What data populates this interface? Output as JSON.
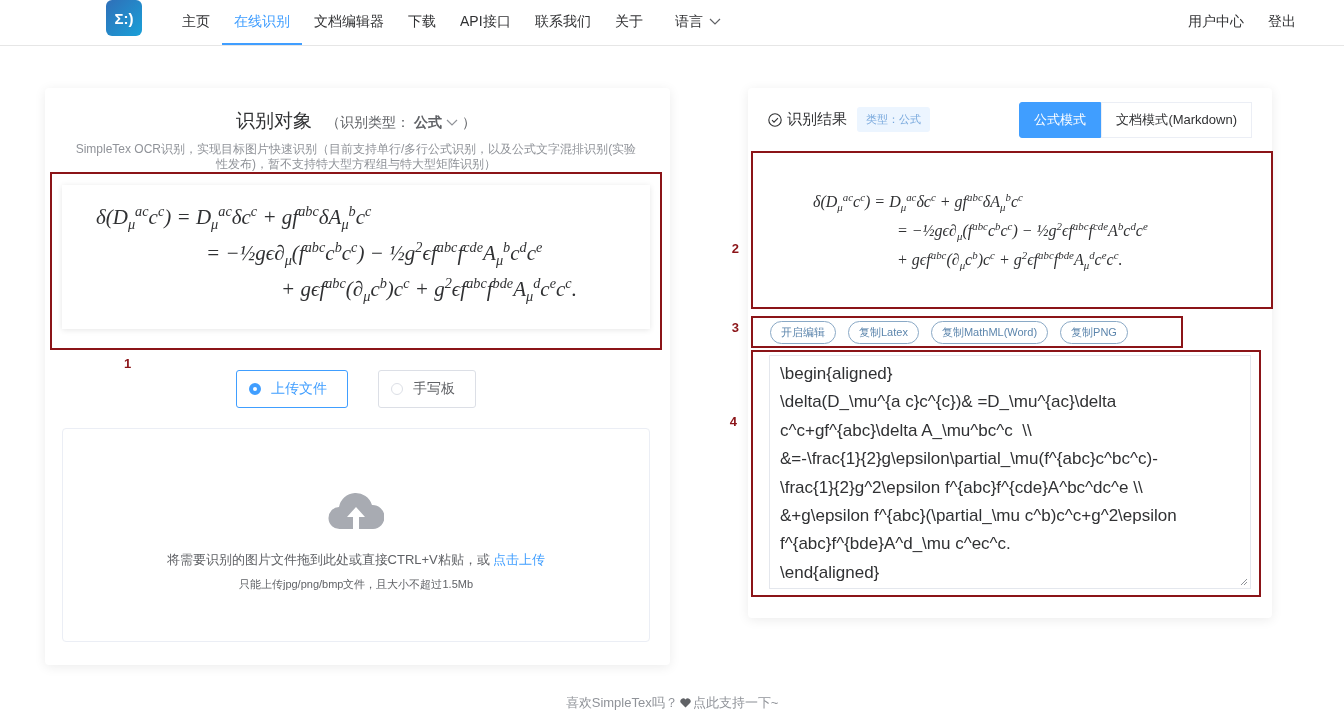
{
  "nav": {
    "logo": "Σ:)",
    "items": [
      {
        "label": "主页",
        "selected": false,
        "kind": "link"
      },
      {
        "label": "在线识别",
        "selected": true,
        "kind": "link"
      },
      {
        "label": "文档编辑器",
        "selected": false,
        "kind": "link"
      },
      {
        "label": "下载",
        "selected": false,
        "kind": "link"
      },
      {
        "label": "API接口",
        "selected": false,
        "kind": "link"
      },
      {
        "label": "联系我们",
        "selected": false,
        "kind": "link"
      },
      {
        "label": "关于",
        "selected": false,
        "kind": "link"
      },
      {
        "label": "语言",
        "selected": false,
        "kind": "dropdown"
      }
    ],
    "user_links": [
      "用户中心",
      "登出"
    ]
  },
  "source_panel": {
    "title": "识别对象",
    "type_label": "（识别类型：",
    "type_value": "公式",
    "type_close": "）",
    "description": "SimpleTex OCR识别，实现目标图片快速识别（目前支持单行/多行公式识别，以及公式文字混排识别(实验性发布)，暂不支持特大型方程组与特大型矩阵识别）",
    "image_lines": [
      "δ(D$_{μ}$$^{ac}$c$^{c}$) = D$_{μ}$$^{ac}$δc$^{c}$ + gf$^{abc}$δA$_{μ}$$^{b}$c$^{c}$",
      "= −½gϵ∂$_{μ}$(f$^{abc}$c$^{b}$c$^{c}$) − ½g$^{2}$ϵf$^{abc}$f$^{cde}$A$_{μ}$$^{b}$c$^{d}$c$^{e}$",
      "+ gϵf$^{abc}$(∂$_{μ}$c$^{b}$)c$^{c}$ + g$^{2}$ϵf$^{abc}$f$^{bde}$A$_{μ}$$^{d}$c$^{e}$c$^{c}$."
    ],
    "annotation": "1",
    "modes": [
      {
        "label": "上传文件",
        "selected": true
      },
      {
        "label": "手写板",
        "selected": false
      }
    ],
    "upload": {
      "prompt": "将需要识别的图片文件拖到此处或直接CTRL+V粘贴，或",
      "link": "点击上传",
      "hint": "只能上传jpg/png/bmp文件，且大小不超过1.5Mb"
    }
  },
  "result_panel": {
    "title": "识别结果",
    "type_tag": "类型：公式",
    "view_modes": [
      {
        "label": "公式模式",
        "selected": true
      },
      {
        "label": "文档模式(Markdown)",
        "selected": false
      }
    ],
    "rendered_lines": [
      "δ(D$_{μ}$$^{ac}$c$^{c}$) = D$_{μ}$$^{ac}$δc$^{c}$ + gf$^{abc}$δA$_{μ}$$^{b}$c$^{c}$",
      "= −½gϵ∂$_{μ}$(f$^{abc}$c$^{b}$c$^{c}$) − ½g$^{2}$ϵf$^{abc}$f$^{cde}$A$^{b}$c$^{d}$c$^{e}$",
      "+ gϵf$^{abc}$(∂$_{μ}$c$^{b}$)c$^{c}$ + g$^{2}$ϵf$^{abc}$f$^{bde}$A$_{μ}$$^{d}$c$^{e}$c$^{c}$."
    ],
    "rendered_annotation": "2",
    "actions": [
      "开启编辑",
      "复制Latex",
      "复制MathML(Word)",
      "复制PNG"
    ],
    "actions_annotation": "3",
    "latex_lines": [
      "\\begin{aligned}",
      "\\delta(D_\\mu^{a c}c^{c})& =D_\\mu^{ac}\\delta",
      "c^c+gf^{abc}\\delta A_\\mu^bc^c  \\\\",
      "&=-\\frac{1}{2}g\\epsilon\\partial_\\mu(f^{abc}c^bc^c)-",
      "\\frac{1}{2}g^2\\epsilon f^{abc}f^{cde}A^bc^dc^e \\\\",
      "&+g\\epsilon f^{abc}(\\partial_\\mu c^b)c^c+g^2\\epsilon",
      "f^{abc}f^{bde}A^d_\\mu c^ec^c.",
      "\\end{aligned}"
    ],
    "source_annotation": "4"
  },
  "footer": {
    "text": "喜欢SimpleTex吗？",
    "link": "点此支持一下~"
  }
}
